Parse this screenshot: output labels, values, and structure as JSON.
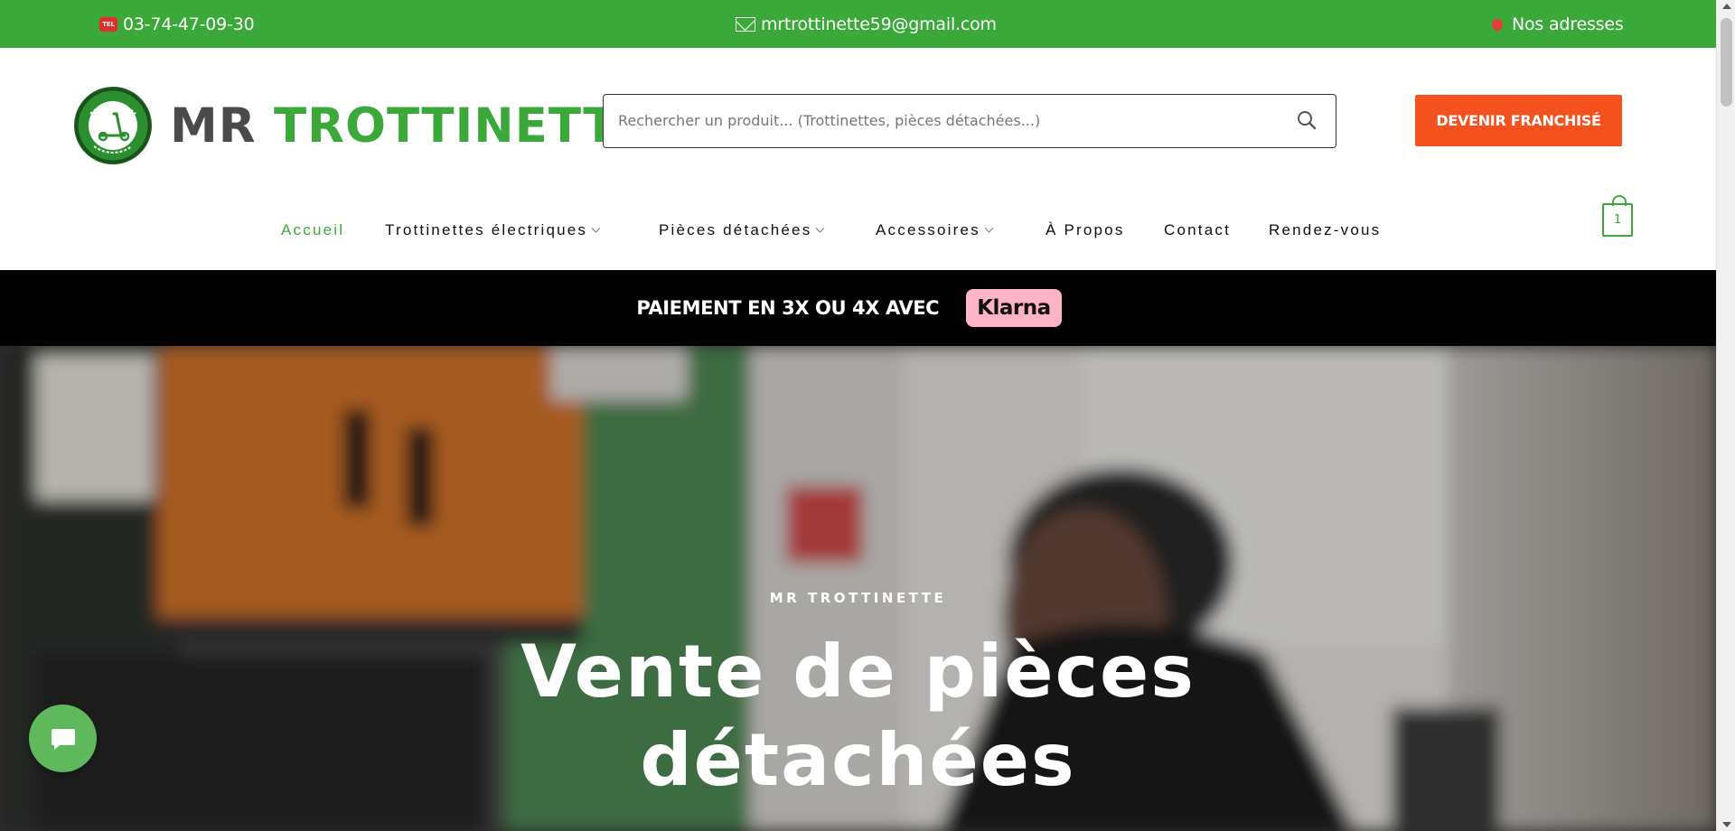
{
  "topbar": {
    "phone": "03-74-47-09-30",
    "email": "mrtrottinette59@gmail.com",
    "address": "Nos adresses",
    "background_color": "#3ba93a",
    "icons": [
      "phone-icon",
      "mail-icon",
      "location-pin-icon"
    ]
  },
  "header": {
    "logo_word1": "MR",
    "logo_word2": "TROTTINETTE",
    "search_placeholder": "Rechercher un produit... (Trottinettes, pièces détachées...)",
    "franchise_label": "DEVENIR FRANCHISÉ",
    "franchise_color": "#f4511e",
    "cart_count": "1"
  },
  "nav": {
    "items": [
      {
        "label": "Accueil",
        "active": true
      },
      {
        "label": "Trottinettes électriques",
        "has_dropdown": true
      },
      {
        "label": "Pièces détachées",
        "has_dropdown": true
      },
      {
        "label": "Accessoires",
        "has_dropdown": true
      },
      {
        "label": "À Propos"
      },
      {
        "label": "Contact"
      },
      {
        "label": "Rendez-vous"
      }
    ]
  },
  "banner": {
    "text": "PAIEMENT EN 3X OU 4X AVEC",
    "brand": "Klarna",
    "brand_color": "#ffb3c7"
  },
  "hero": {
    "eyebrow": "MR TROTTINETTE",
    "title_line1": "Vente de pièces",
    "title_line2": "détachées"
  },
  "chat": {
    "icon": "chat-bubble-icon"
  }
}
